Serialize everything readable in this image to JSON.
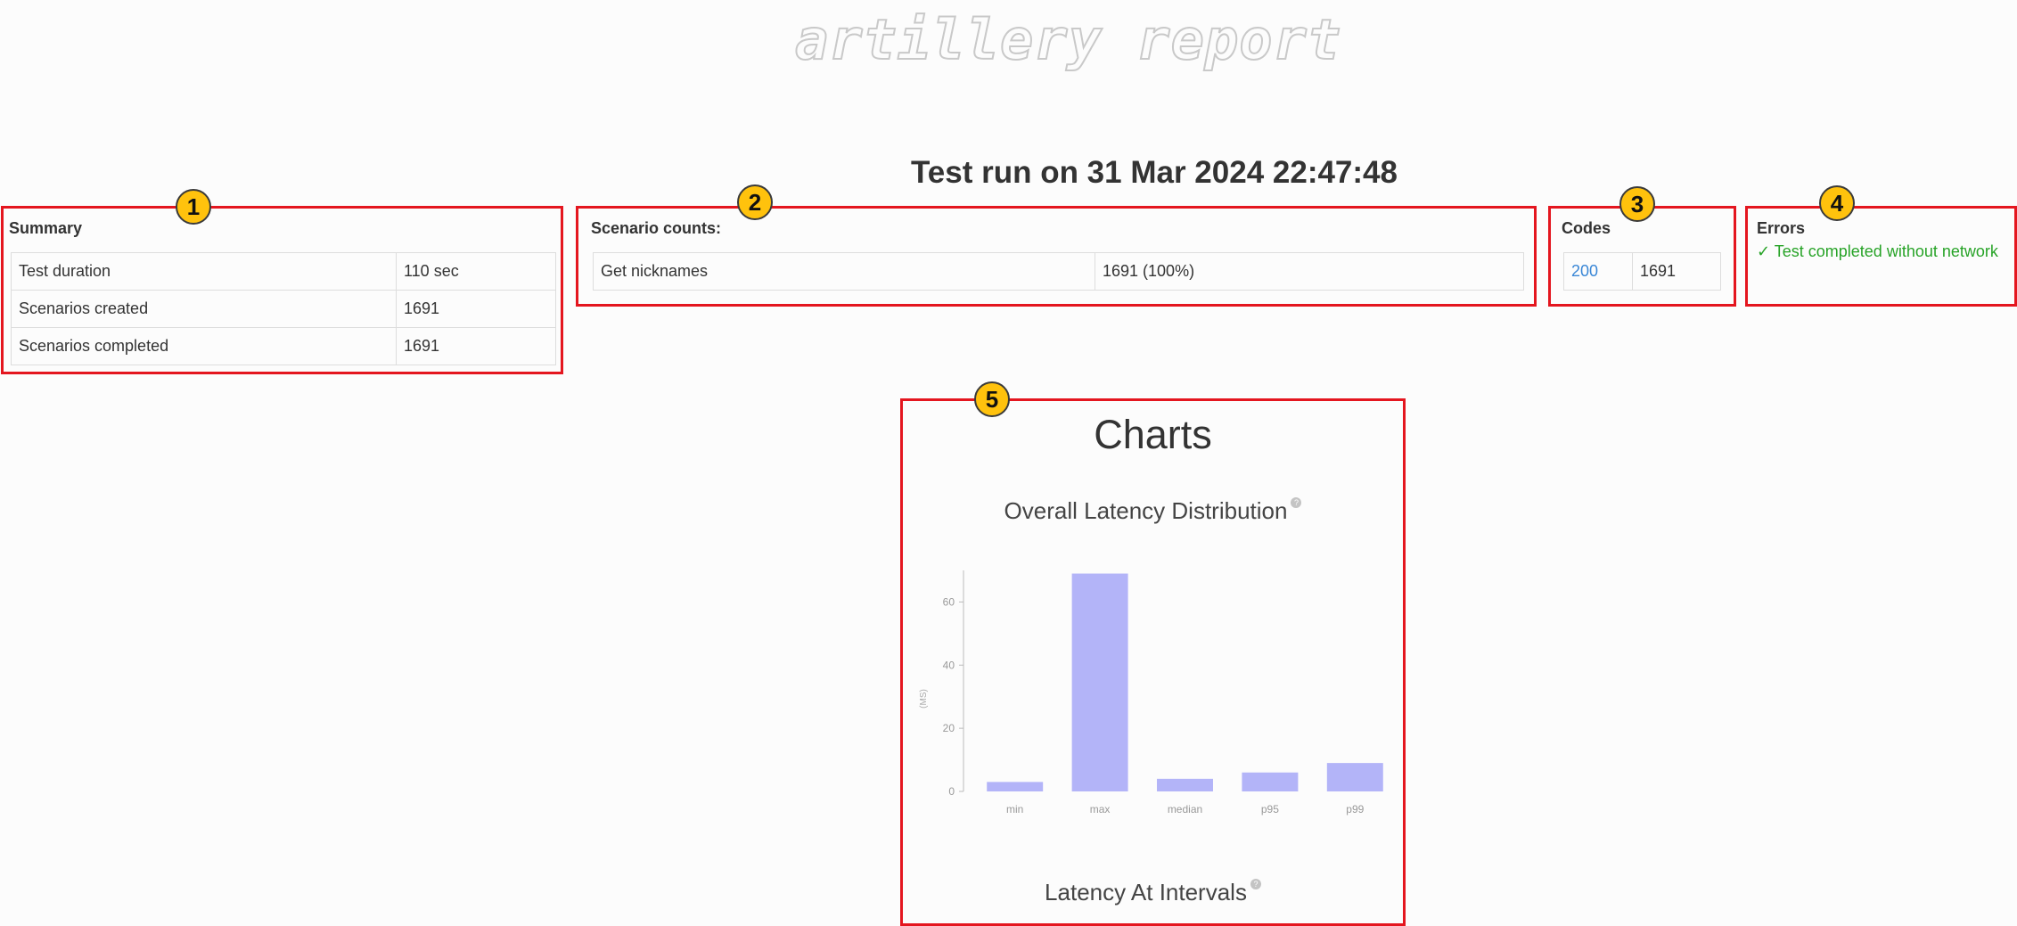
{
  "logo_text": "artillery report",
  "run_title": "Test run on 31 Mar 2024 22:47:48",
  "badges": [
    "1",
    "2",
    "3",
    "4",
    "5"
  ],
  "summary": {
    "title": "Summary",
    "rows": [
      {
        "label": "Test duration",
        "value": "110 sec"
      },
      {
        "label": "Scenarios created",
        "value": "1691"
      },
      {
        "label": "Scenarios completed",
        "value": "1691"
      }
    ]
  },
  "scenario_counts": {
    "title": "Scenario counts:",
    "rows": [
      {
        "label": "Get nicknames",
        "value": "1691 (100%)"
      }
    ]
  },
  "codes": {
    "title": "Codes",
    "rows": [
      {
        "code": "200",
        "count": "1691"
      }
    ]
  },
  "errors": {
    "title": "Errors",
    "message": "✓ Test completed without network"
  },
  "charts": {
    "title": "Charts",
    "latency_title": "Overall Latency Distribution",
    "intervals_title": "Latency At Intervals",
    "help_glyph": "?"
  },
  "chart_data": {
    "type": "bar",
    "categories": [
      "min",
      "max",
      "median",
      "p95",
      "p99"
    ],
    "values": [
      3,
      69,
      4,
      6,
      9
    ],
    "ylabel": "(MS)",
    "yticks": [
      0,
      20,
      40,
      60
    ],
    "ylim": [
      0,
      70
    ],
    "bar_color": "#b3b4f8",
    "grid": false
  }
}
